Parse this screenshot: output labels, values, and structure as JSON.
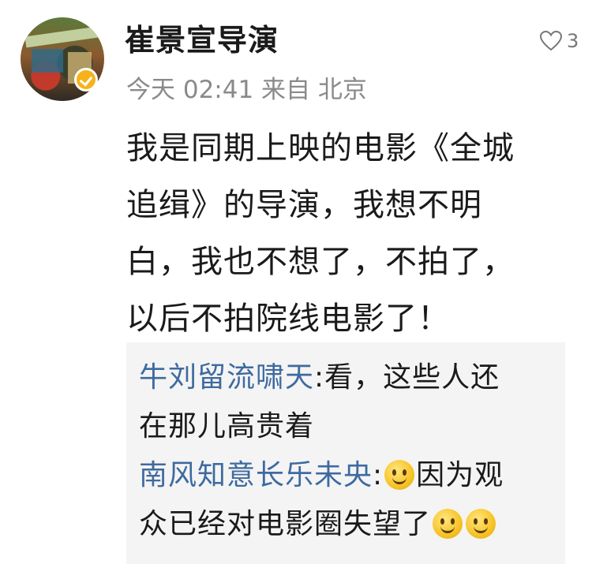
{
  "post": {
    "username": "崔景宣导演",
    "meta": "今天 02:41 来自 北京",
    "like_count": "3",
    "content_lines": [
      "我是同期上映的电影《全城",
      "追缉》的导演，我想不明",
      "白，我也不想了，不拍了，",
      "以后不拍院线电影了！"
    ]
  },
  "replies": [
    {
      "author": "牛刘留流啸天",
      "line1": "看，这些人还",
      "line2": "在那儿高贵着"
    },
    {
      "author": "南风知意长乐未央",
      "line1": "因为观",
      "line2": "众已经对电影圈失望了"
    }
  ],
  "icons": {
    "like": "heart-outline-icon",
    "verified": "verified-badge-icon",
    "emoji": "smile-emoji-icon"
  },
  "colors": {
    "author_link": "#3e6aa0",
    "meta_text": "#8a8a8a",
    "verified_badge": "#f6b21a",
    "reply_bg": "#f4f4f4"
  }
}
